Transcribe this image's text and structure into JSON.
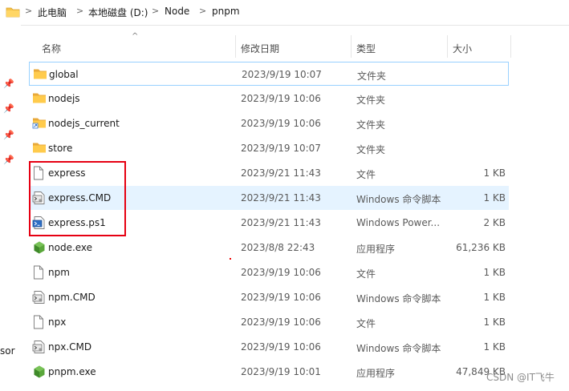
{
  "breadcrumb": {
    "items": [
      "此电脑",
      "本地磁盘 (D:)",
      "Node",
      "pnpm"
    ],
    "separator": ">"
  },
  "nav": {
    "cut_text": "sor"
  },
  "columns": {
    "name": "名称",
    "date": "修改日期",
    "type": "类型",
    "size": "大小"
  },
  "files": [
    {
      "name": "global",
      "date": "2023/9/19 10:07",
      "type": "文件夹",
      "size": "",
      "icon": "folder-icon",
      "state": "selected"
    },
    {
      "name": "nodejs",
      "date": "2023/9/19 10:06",
      "type": "文件夹",
      "size": "",
      "icon": "folder-icon",
      "state": ""
    },
    {
      "name": "nodejs_current",
      "date": "2023/9/19 10:06",
      "type": "文件夹",
      "size": "",
      "icon": "folder-shortcut-icon",
      "state": ""
    },
    {
      "name": "store",
      "date": "2023/9/19 10:07",
      "type": "文件夹",
      "size": "",
      "icon": "folder-icon",
      "state": ""
    },
    {
      "name": "express",
      "date": "2023/9/21 11:43",
      "type": "文件",
      "size": "1 KB",
      "icon": "file-icon",
      "state": ""
    },
    {
      "name": "express.CMD",
      "date": "2023/9/21 11:43",
      "type": "Windows 命令脚本",
      "size": "1 KB",
      "icon": "cmd-script-icon",
      "state": "hover"
    },
    {
      "name": "express.ps1",
      "date": "2023/9/21 11:43",
      "type": "Windows Power...",
      "size": "2 KB",
      "icon": "powershell-script-icon",
      "state": ""
    },
    {
      "name": "node.exe",
      "date": "2023/8/8 22:43",
      "type": "应用程序",
      "size": "61,236 KB",
      "icon": "node-exe-icon",
      "state": ""
    },
    {
      "name": "npm",
      "date": "2023/9/19 10:06",
      "type": "文件",
      "size": "1 KB",
      "icon": "file-icon",
      "state": ""
    },
    {
      "name": "npm.CMD",
      "date": "2023/9/19 10:06",
      "type": "Windows 命令脚本",
      "size": "1 KB",
      "icon": "cmd-script-icon",
      "state": ""
    },
    {
      "name": "npx",
      "date": "2023/9/19 10:06",
      "type": "文件",
      "size": "1 KB",
      "icon": "file-icon",
      "state": ""
    },
    {
      "name": "npx.CMD",
      "date": "2023/9/19 10:06",
      "type": "Windows 命令脚本",
      "size": "1 KB",
      "icon": "cmd-script-icon",
      "state": ""
    },
    {
      "name": "pnpm.exe",
      "date": "2023/9/19 10:01",
      "type": "应用程序",
      "size": "47,849 KB",
      "icon": "node-exe-icon",
      "state": ""
    }
  ],
  "watermark": "CSDN @IT飞牛",
  "colors": {
    "selection_border": "#99d1ff",
    "hover_bg": "#e5f3ff",
    "annotation_red": "#e60012",
    "folder_yellow": "#f6c34a"
  }
}
